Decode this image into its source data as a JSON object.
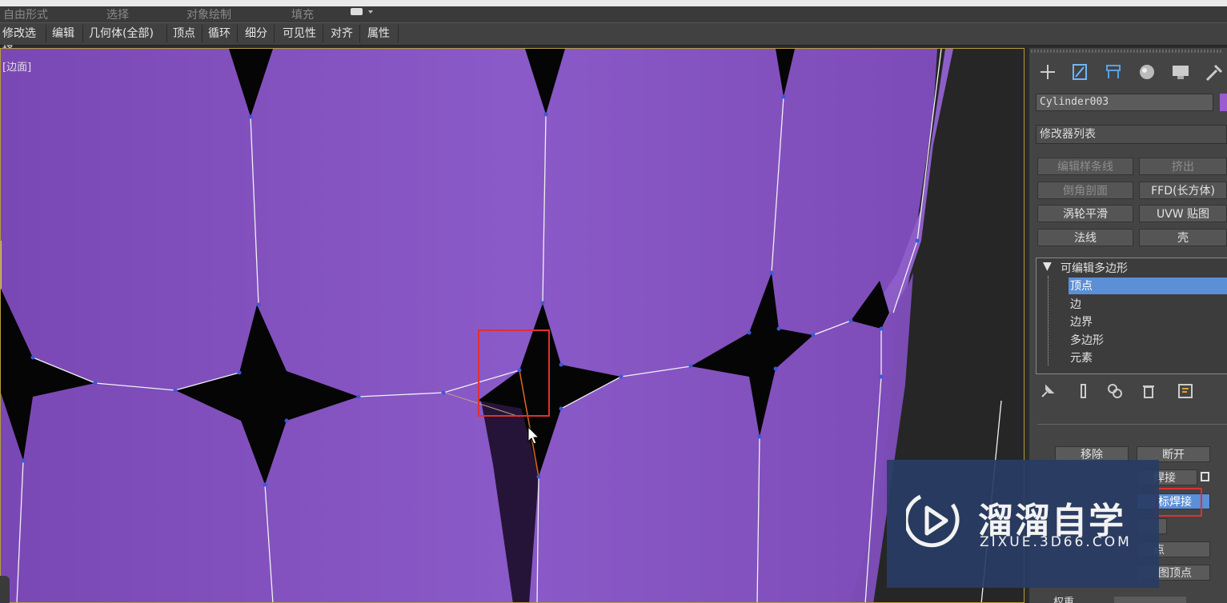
{
  "ribbon": {
    "items": [
      "自由形式",
      "选择",
      "对象绘制",
      "填充"
    ]
  },
  "toolbar": {
    "items": [
      "修改选择",
      "编辑",
      "几何体(全部)",
      "顶点",
      "循环",
      "细分",
      "可见性",
      "对齐",
      "属性"
    ]
  },
  "viewport": {
    "label": "[边面]"
  },
  "panel": {
    "tab_icons": [
      "create-icon",
      "modify-icon",
      "hierarchy-icon",
      "motion-icon",
      "display-icon",
      "utilities-icon"
    ],
    "object_name": "Cylinder003",
    "object_color": "#9a5ad0",
    "modifier_list": "修改器列表",
    "modifier_buttons": [
      "编辑样条线",
      "挤出",
      "倒角剖面",
      "FFD(长方体)",
      "涡轮平滑",
      "UVW 贴图",
      "法线",
      "壳"
    ],
    "stack": {
      "root": "可编辑多边形",
      "items": [
        "顶点",
        "边",
        "边界",
        "多边形",
        "元素"
      ],
      "selected": "顶点"
    },
    "edit_buttons": {
      "remove": "移除",
      "break": "断开",
      "weld_partial": "焊接",
      "target_weld_partial": "标焊接",
      "vertex_partial": "点",
      "map_vertex_partial": "图顶点",
      "weight_partial": "权重"
    }
  },
  "watermark": {
    "main": "溜溜自学",
    "sub": "ZIXUE.3D66.COM"
  },
  "colors": {
    "mesh": "#8756c0",
    "highlight_box": "#e03030",
    "selection": "#5b8fd6"
  }
}
